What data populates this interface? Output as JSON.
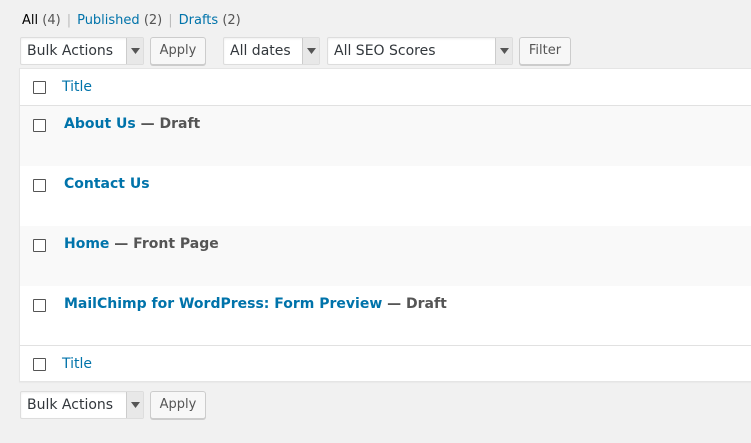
{
  "views": [
    {
      "label": "All",
      "count": "(4)"
    },
    {
      "label": "Published",
      "count": "(2)"
    },
    {
      "label": "Drafts",
      "count": "(2)"
    }
  ],
  "views_separator": "|",
  "top_nav": {
    "bulk_actions": "Bulk Actions",
    "apply_label": "Apply",
    "dates_filter": "All dates",
    "seo_filter": "All SEO Scores",
    "filter_label": "Filter"
  },
  "table": {
    "header_title": "Title",
    "footer_title": "Title",
    "rows": [
      {
        "title": "About Us",
        "state": " — Draft"
      },
      {
        "title": "Contact Us",
        "state": ""
      },
      {
        "title": "Home",
        "state": " — Front Page"
      },
      {
        "title": "MailChimp for WordPress: Form Preview",
        "state": " — Draft"
      }
    ]
  },
  "bottom_nav": {
    "bulk_actions": "Bulk Actions",
    "apply_label": "Apply"
  },
  "icons": {
    "dropdown": "chevron-down-icon"
  },
  "colors": {
    "link": "#0073aa",
    "background": "#f1f1f1",
    "row_alt": "#f9f9f9"
  }
}
